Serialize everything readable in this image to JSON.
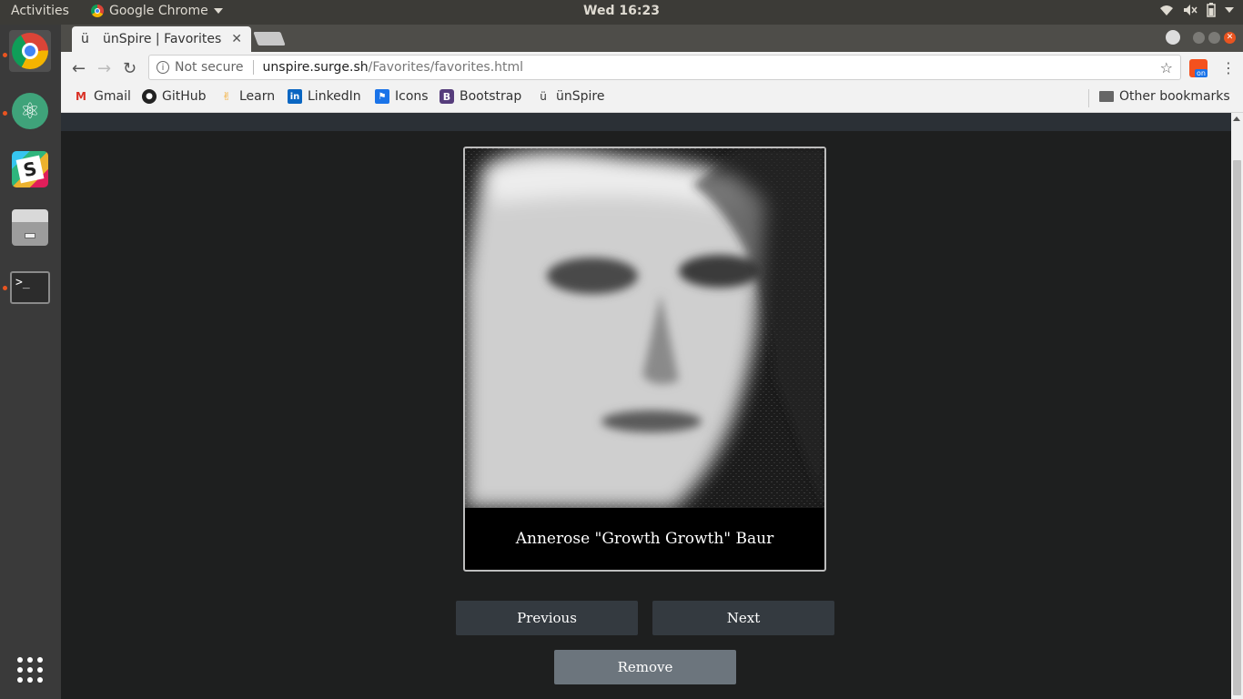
{
  "system_bar": {
    "activities": "Activities",
    "app_name": "Google Chrome",
    "clock": "Wed 16:23"
  },
  "browser": {
    "tab_title": "ünSpire | Favorites",
    "tab_favicon": "ü",
    "security_label": "Not secure",
    "url_host": "unspire.surge.sh",
    "url_path": "/Favorites/favorites.html",
    "extension_badge": "on",
    "bookmarks": [
      {
        "label": "Gmail",
        "icon": "gmail-icon"
      },
      {
        "label": "GitHub",
        "icon": "github-icon"
      },
      {
        "label": "Learn",
        "icon": "learn-icon"
      },
      {
        "label": "LinkedIn",
        "icon": "linkedin-icon"
      },
      {
        "label": "Icons",
        "icon": "icons-flag-icon"
      },
      {
        "label": "Bootstrap",
        "icon": "bootstrap-icon"
      },
      {
        "label": "ünSpire",
        "icon": "unspire-icon"
      }
    ],
    "other_bookmarks": "Other bookmarks"
  },
  "dock": {
    "apps": [
      "chrome-icon",
      "atom-icon",
      "slack-icon",
      "files-icon",
      "terminal-icon",
      "app-grid-icon"
    ]
  },
  "favorites": {
    "caption": "Annerose \"Growth Growth\" Baur",
    "previous_label": "Previous",
    "next_label": "Next",
    "remove_label": "Remove"
  },
  "colors": {
    "page_bg": "#1e1f1f",
    "button_dark": "#343a40",
    "button_gray": "#6c757d",
    "ubuntu_orange": "#e95420"
  }
}
